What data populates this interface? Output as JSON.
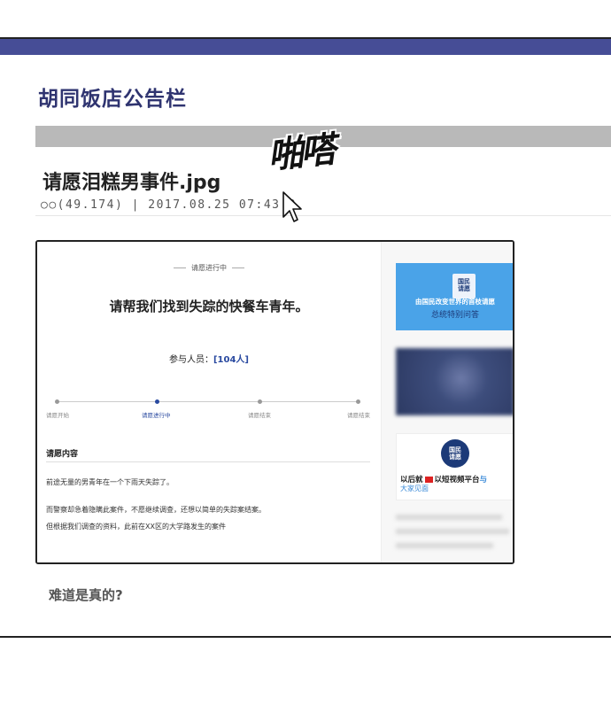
{
  "board": {
    "title": "胡同饭店公告栏"
  },
  "sound_effect": "啪嗒",
  "post": {
    "title": "请愿泪糕男事件.jpg",
    "meta": "○○(49.174) | 2017.08.25 07:43:3"
  },
  "petition": {
    "status_label": "请愿进行中",
    "title": "请帮我们找到失踪的快餐车青年。",
    "participants_label": "参与人员：",
    "participants_count": "[104人]",
    "steps": [
      "请愿开始",
      "请愿进行中",
      "请愿结束",
      "请愿结束"
    ],
    "content_heading": "请愿内容",
    "content_lines": [
      "前途无量的男青年在一个下雨天失踪了。",
      "而警察却急着隐瞒此案件，不愿继续调查，还想以简单的失踪案结案。",
      "但根据我们调查的资料，此前在XX区的大学路发生的案件"
    ]
  },
  "sidebar_ads": {
    "ad1_tag": "国民\n请愿",
    "ad1_line1": "由国民改变世界的首枝请愿",
    "ad1_line2": "总统特别问答",
    "ad3_badge": "国民\n请愿",
    "ad3_line1_a": "以后就",
    "ad3_line1_b": "以短视频平台",
    "ad3_line1_c": "与",
    "ad3_line2": "大家见面"
  },
  "comment": "难道是真的?",
  "colors": {
    "topbar": "#464d96",
    "title": "#2f3470",
    "accent": "#2a4aa0",
    "ad_blue": "#4aa3e8"
  }
}
